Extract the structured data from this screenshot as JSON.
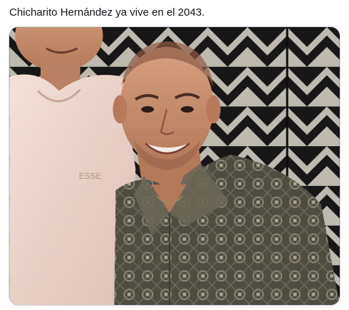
{
  "post": {
    "text": "Chicharito Hernández ya vive en el 2043."
  },
  "media": {
    "type": "photo",
    "alt_subject": "two-people-portrait",
    "shirt_print_text": "ESSE"
  },
  "colors": {
    "text": "#0f1419",
    "border": "#cfd9de",
    "wall_dark": "#1b1b1b",
    "wall_light": "#d9d4c8",
    "skin": "#c98f6c",
    "shirt_patterned": "#5d5b4e",
    "shirt_pink": "#efd8cf"
  }
}
